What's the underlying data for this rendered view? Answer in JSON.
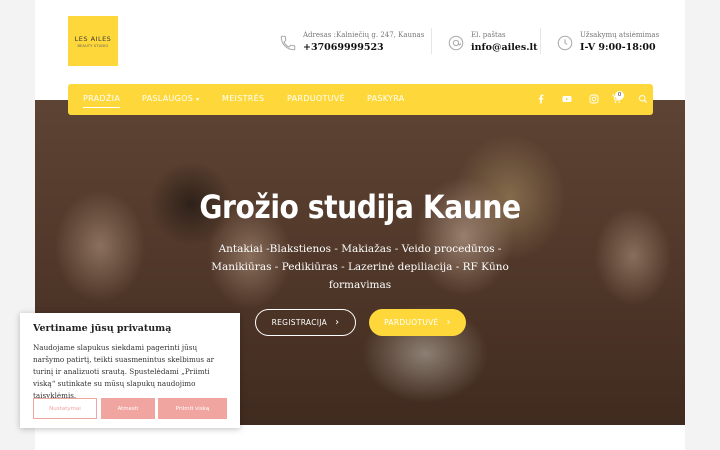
{
  "logo": {
    "line1": "LES AILES",
    "line2": "BEAUTY STUDIO"
  },
  "contacts": [
    {
      "icon": "phone-icon",
      "label": "Adresas :Kalniečių g. 247, Kaunas",
      "value": "+37069999523"
    },
    {
      "icon": "at-icon",
      "label": "El. paštas",
      "value": "info@ailes.lt"
    },
    {
      "icon": "clock-icon",
      "label": "Užsakymų atsiėmimas",
      "value": "I-V 9:00-18:00"
    }
  ],
  "nav": {
    "items": [
      {
        "label": "PRADŽIA",
        "active": true
      },
      {
        "label": "PASLAUGOS",
        "dropdown": true
      },
      {
        "label": "MEISTRĖS"
      },
      {
        "label": "PARDUOTUVĖ"
      },
      {
        "label": "PASKYRA"
      }
    ],
    "social": [
      "facebook-icon",
      "youtube-icon",
      "instagram-icon",
      "cart-icon",
      "search-icon"
    ],
    "cart_count": "0"
  },
  "hero": {
    "title": "Grožio studija Kaune",
    "subtitle": "Antakiai -Blakstienos - Makiažas - Veido procedūros - Manikiūras - Pedikiūras - Lazerinė depiliacija - RF Kūno formavimas",
    "button_register": "REGISTRACIJA",
    "button_shop": "PARDUOTUVĖ"
  },
  "cookie": {
    "title": "Vertiname jūsų privatumą",
    "text": "Naudojame slapukus siekdami pagerinti jūsų naršymo patirtį, teikti suasmenintus skelbimus ar turinį ir analizuoti srautą. Spustelėdami „Priimti viską“ sutinkate su mūsų slapukų naudojimo taisyklėmis.",
    "btn_settings": "Nustatymai",
    "btn_reject": "Atmesti",
    "btn_accept": "Priimti viską"
  },
  "colors": {
    "accent": "#fed83a",
    "cookie_button": "#f0a5a0"
  }
}
